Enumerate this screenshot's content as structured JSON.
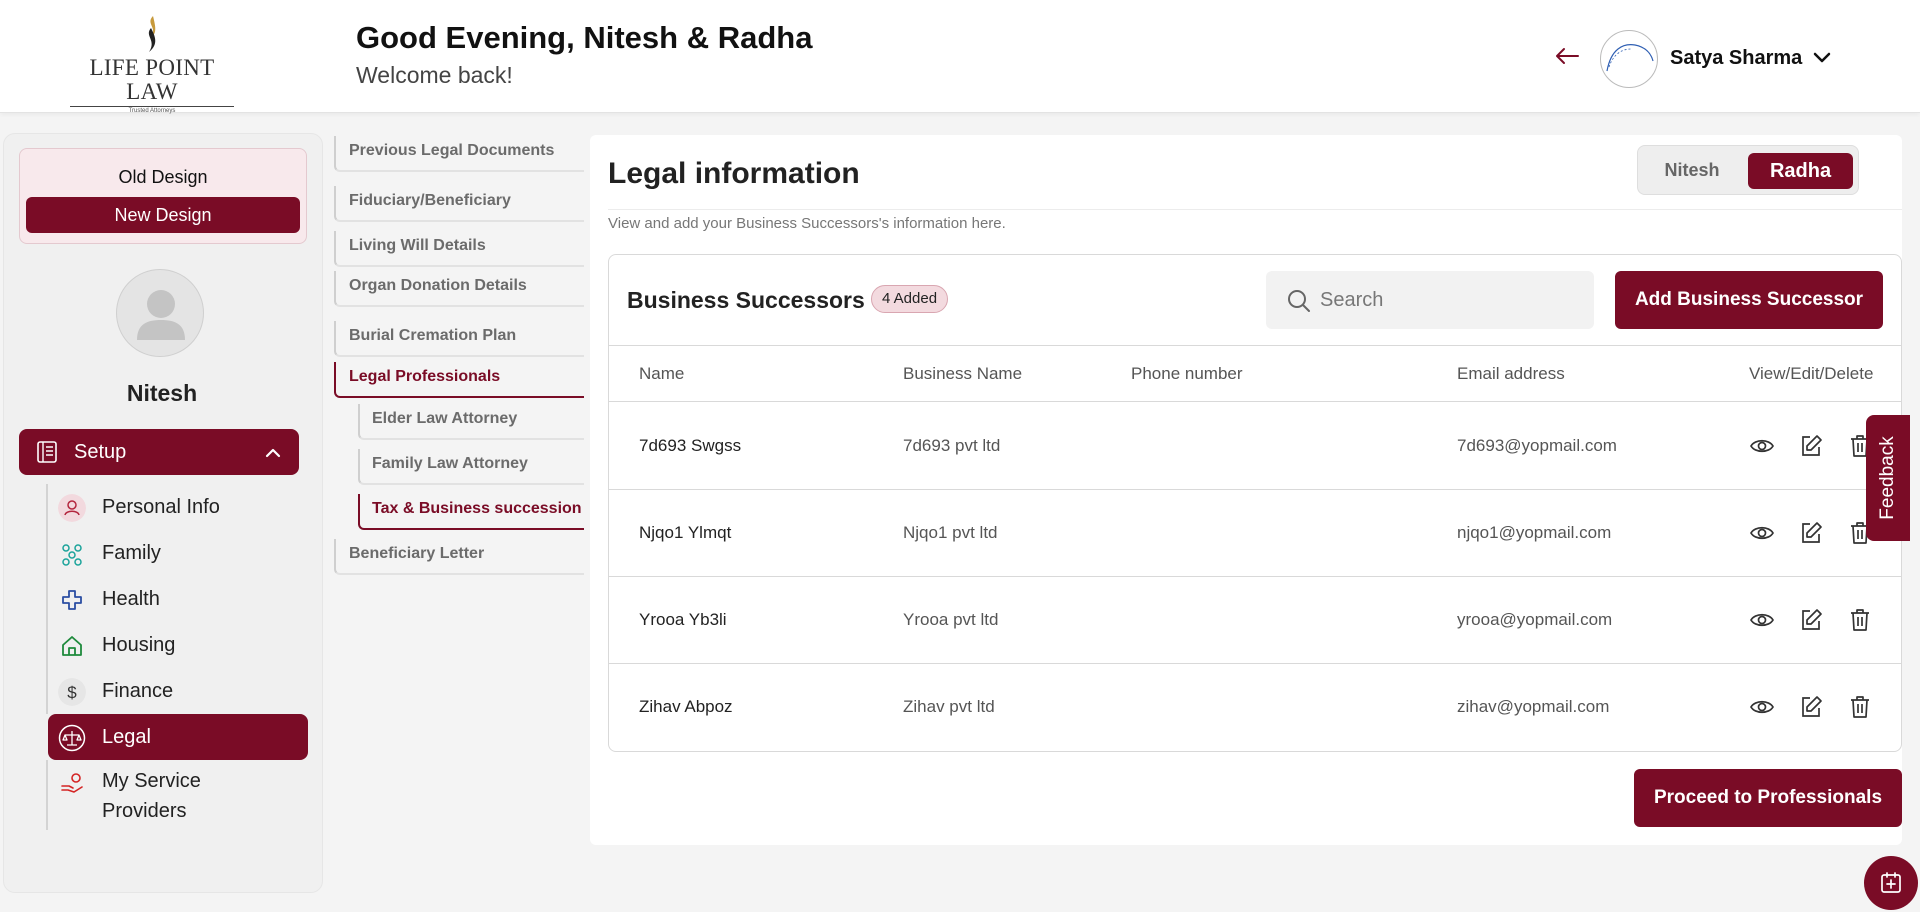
{
  "header": {
    "logo_text": "LIFE POINT LAW",
    "logo_tagline": "Trusted Attorneys",
    "greeting": "Good Evening, Nitesh & Radha",
    "welcome": "Welcome back!",
    "user_name": "Satya Sharma"
  },
  "sidebar": {
    "old_design_label": "Old Design",
    "new_design_label": "New Design",
    "profile_name": "Nitesh",
    "setup_label": "Setup",
    "items": [
      {
        "label": "Personal Info",
        "icon": "user-icon",
        "color": "#b3263e"
      },
      {
        "label": "Family",
        "icon": "family-tree-icon",
        "color": "#1aa39a"
      },
      {
        "label": "Health",
        "icon": "health-cross-icon",
        "color": "#2b4ea3"
      },
      {
        "label": "Housing",
        "icon": "house-icon",
        "color": "#1e8a3c"
      },
      {
        "label": "Finance",
        "icon": "dollar-icon",
        "color": "#333333"
      },
      {
        "label": "Legal",
        "icon": "scale-icon",
        "color": "#ffffff"
      },
      {
        "label": "My Service Providers",
        "icon": "service-hand-icon",
        "color": "#d42424"
      }
    ]
  },
  "subnav": {
    "items": [
      {
        "label": "Previous Legal Documents"
      },
      {
        "label": "Fiduciary/Beneficiary"
      },
      {
        "label": "Living Will Details"
      },
      {
        "label": "Organ Donation Details"
      },
      {
        "label": "Burial Cremation Plan"
      },
      {
        "label": "Legal Professionals"
      },
      {
        "label": "Elder Law Attorney"
      },
      {
        "label": "Family Law Attorney"
      },
      {
        "label": "Tax & Business succession"
      },
      {
        "label": "Beneficiary Letter"
      }
    ]
  },
  "main": {
    "title": "Legal information",
    "subtitle": "View and add your Business Successors's information here.",
    "toggle": {
      "left": "Nitesh",
      "right": "Radha"
    },
    "card_title": "Business Successors",
    "badge": "4 Added",
    "search_placeholder": "Search",
    "add_button": "Add Business Successor",
    "columns": [
      "Name",
      "Business Name",
      "Phone number",
      "Email address",
      "View/Edit/Delete"
    ],
    "rows": [
      {
        "name": "7d693 Swgss",
        "business": "7d693 pvt ltd",
        "phone": "",
        "email": "7d693@yopmail.com"
      },
      {
        "name": "Njqo1 Ylmqt",
        "business": "Njqo1 pvt ltd",
        "phone": "",
        "email": "njqo1@yopmail.com"
      },
      {
        "name": "Yrooa Yb3li",
        "business": "Yrooa pvt ltd",
        "phone": "",
        "email": "yrooa@yopmail.com"
      },
      {
        "name": "Zihav Abpoz",
        "business": "Zihav pvt ltd",
        "phone": "",
        "email": "zihav@yopmail.com"
      }
    ],
    "proceed_button": "Proceed to Professionals"
  },
  "feedback_label": "Feedback",
  "colors": {
    "accent": "#7a0c26",
    "badge_bg": "#f3dadf"
  }
}
